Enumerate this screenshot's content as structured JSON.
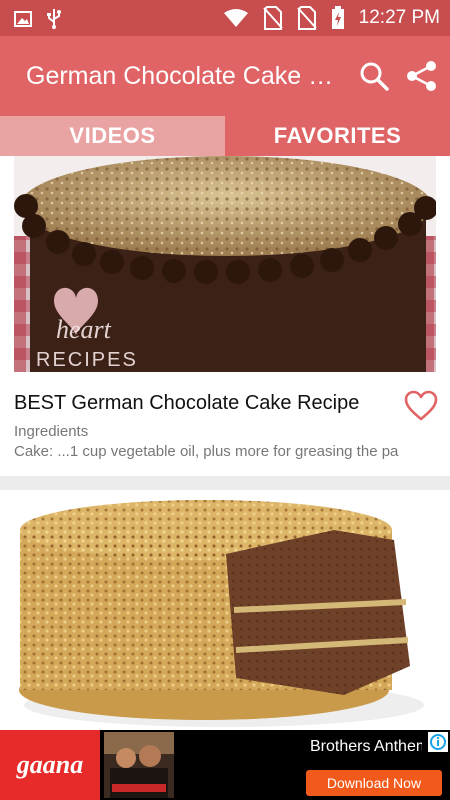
{
  "status_bar": {
    "time": "12:27 PM",
    "icons": [
      "image-icon",
      "usb-icon",
      "wifi-icon",
      "no-sim-icon",
      "no-sim-icon",
      "battery-charging-icon"
    ]
  },
  "app_bar": {
    "title": "German Chocolate Cake Recipes",
    "search_icon": "search-icon",
    "share_icon": "share-icon"
  },
  "tabs": [
    {
      "label": "VIDEOS",
      "selected": false
    },
    {
      "label": "FAVORITES",
      "selected": true
    }
  ],
  "videos": [
    {
      "title": "BEST German Chocolate Cake Recipe",
      "subtitle": "Ingredients",
      "description": "Cake: ...1 cup vegetable oil, plus more for greasing the pa",
      "thumbnail_watermark": "I heart RECIPES",
      "favorite_icon": "heart-outline-icon"
    },
    {
      "title": "",
      "subtitle": "",
      "description": "",
      "favorite_icon": "heart-outline-icon"
    }
  ],
  "ad": {
    "brand": "gaana",
    "title": "Brothers Anthem",
    "cta": "Download Now",
    "info_icon": "ad-info-icon"
  },
  "colors": {
    "status_bar": "#c74d4f",
    "app_bar": "#e06466",
    "tab_selected": "#df6466",
    "tab_unselected": "#e9a3a3",
    "heart": "#e06466",
    "ad_cta": "#f25a1c"
  }
}
